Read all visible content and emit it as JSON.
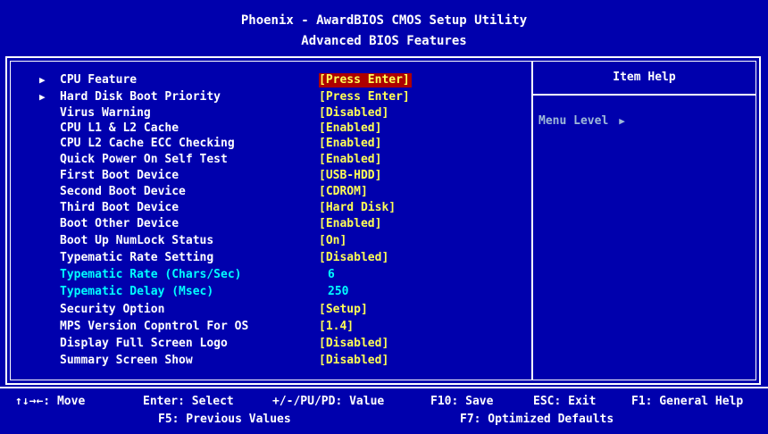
{
  "header": {
    "title": "Phoenix - AwardBIOS CMOS Setup Utility",
    "subtitle": "Advanced BIOS Features"
  },
  "settings": [
    {
      "label": "CPU Feature",
      "value": "[Press Enter]",
      "submenu": true,
      "selected": true,
      "enabled": true
    },
    {
      "label": "Hard Disk Boot Priority",
      "value": "[Press Enter]",
      "submenu": true,
      "selected": false,
      "enabled": true
    },
    {
      "label": "Virus Warning",
      "value": "[Disabled]",
      "submenu": false,
      "selected": false,
      "enabled": true
    },
    {
      "label": "CPU L1 & L2 Cache",
      "value": "[Enabled]",
      "submenu": false,
      "selected": false,
      "enabled": true
    },
    {
      "label": "CPU L2 Cache ECC Checking",
      "value": "[Enabled]",
      "submenu": false,
      "selected": false,
      "enabled": true
    },
    {
      "label": "Quick Power On Self Test",
      "value": "[Enabled]",
      "submenu": false,
      "selected": false,
      "enabled": true
    },
    {
      "label": "First Boot Device",
      "value": "[USB-HDD]",
      "submenu": false,
      "selected": false,
      "enabled": true
    },
    {
      "label": "Second Boot Device",
      "value": "[CDROM]",
      "submenu": false,
      "selected": false,
      "enabled": true
    },
    {
      "label": "Third Boot Device",
      "value": "[Hard Disk]",
      "submenu": false,
      "selected": false,
      "enabled": true
    },
    {
      "label": "Boot Other Device",
      "value": "[Enabled]",
      "submenu": false,
      "selected": false,
      "enabled": true
    },
    {
      "label": "Boot Up NumLock Status",
      "value": "[On]",
      "submenu": false,
      "selected": false,
      "enabled": true
    },
    {
      "label": "Typematic Rate Setting",
      "value": "[Disabled]",
      "submenu": false,
      "selected": false,
      "enabled": true
    },
    {
      "label": "Typematic Rate (Chars/Sec)",
      "value": "6",
      "submenu": false,
      "selected": false,
      "enabled": false
    },
    {
      "label": "Typematic Delay (Msec)",
      "value": "250",
      "submenu": false,
      "selected": false,
      "enabled": false
    },
    {
      "label": "Security Option",
      "value": "[Setup]",
      "submenu": false,
      "selected": false,
      "enabled": true
    },
    {
      "label": "MPS Version Copntrol For OS",
      "value": "[1.4]",
      "submenu": false,
      "selected": false,
      "enabled": true
    },
    {
      "label": "Display Full Screen Logo",
      "value": "[Disabled]",
      "submenu": false,
      "selected": false,
      "enabled": true
    },
    {
      "label": "Summary Screen Show",
      "value": "[Disabled]",
      "submenu": false,
      "selected": false,
      "enabled": true
    }
  ],
  "help": {
    "title": "Item Help",
    "menu_level_label": "Menu Level",
    "menu_level_marker": "▶"
  },
  "submenu_marker": "▶",
  "footer": {
    "move": "↑↓→←: Move",
    "select": "Enter: Select",
    "value": "+/-/PU/PD: Value",
    "save": "F10: Save",
    "exit": "ESC: Exit",
    "general_help": "F1: General Help",
    "previous_values": "F5: Previous Values",
    "optimized_defaults": "F7: Optimized Defaults"
  },
  "colors": {
    "background": "#0000ad",
    "value": "#ffff55",
    "disabled": "#00ffff",
    "highlight": "#ad0000"
  }
}
